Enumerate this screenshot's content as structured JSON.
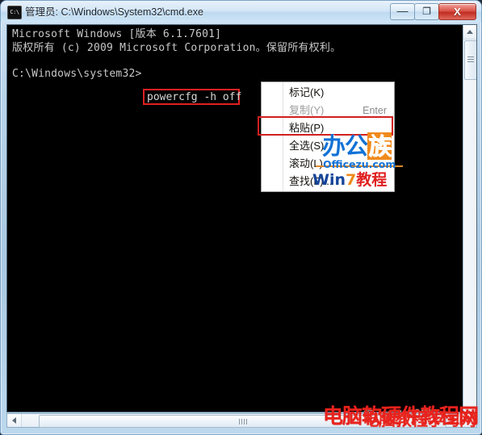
{
  "window": {
    "title": "管理员: C:\\Windows\\System32\\cmd.exe",
    "icon_name": "cmd-icon",
    "icon_text": "C:\\",
    "controls": {
      "minimize_label": "—",
      "maximize_label": "❐",
      "close_label": "X"
    }
  },
  "console": {
    "lines": [
      "Microsoft Windows [版本 6.1.7601]",
      "版权所有 (c) 2009 Microsoft Corporation。保留所有权利。",
      "C:\\Windows\\system32>"
    ],
    "command": "powercfg -h off",
    "background_color": "#000000",
    "text_color": "#c8c8c8",
    "highlight_color": "#e02020",
    "watermark": "officezu.com"
  },
  "context_menu": {
    "items": [
      {
        "label": "标记(K)",
        "accel": "",
        "disabled": false
      },
      {
        "label": "复制(Y)",
        "accel": "Enter",
        "disabled": true
      },
      {
        "label": "粘贴(P)",
        "accel": "",
        "disabled": false
      },
      {
        "label": "全选(S)",
        "accel": "",
        "disabled": false
      },
      {
        "label": "滚动(L)",
        "accel": "",
        "disabled": false
      },
      {
        "label": "查找(F)...",
        "accel": "",
        "disabled": false
      }
    ],
    "highlighted_item": "粘贴(P)",
    "highlight_color": "#d21f1f"
  },
  "watermark": {
    "brand_a": "办",
    "brand_b": "公",
    "brand_c": "族",
    "site": "Officezu.com",
    "tag_prefix": "Win",
    "tag_seven": "7",
    "tag_suffix": "教程",
    "brand_color": "#1372d6",
    "accent_color": "#f08a1c",
    "bottom_text_1": "电脑软硬件教程网",
    "bottom_text_2": "电脑教程学习网",
    "bottom_color": "#e8231c"
  },
  "scrollbars": {
    "vertical_up_label": "▲",
    "horizontal_left_label": "◀"
  }
}
